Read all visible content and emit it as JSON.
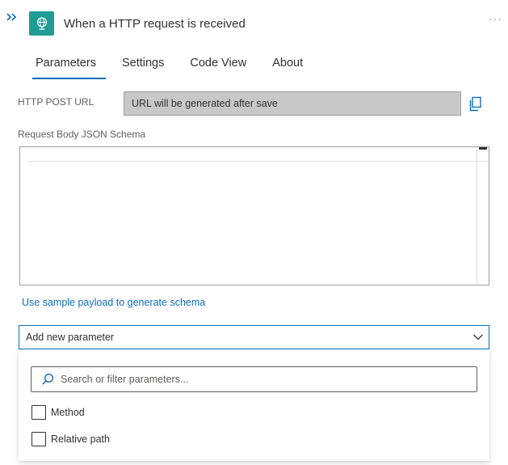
{
  "header": {
    "title": "When a HTTP request is received",
    "collapse_icon": "double-chevron-right-icon",
    "trigger_icon": "globe-request-icon",
    "more_label": "···"
  },
  "tabs": [
    {
      "label": "Parameters",
      "active": true
    },
    {
      "label": "Settings",
      "active": false
    },
    {
      "label": "Code View",
      "active": false
    },
    {
      "label": "About",
      "active": false
    }
  ],
  "fields": {
    "post_url_label": "HTTP POST URL",
    "post_url_value": "URL will be generated after save",
    "schema_label": "Request Body JSON Schema",
    "schema_value": ""
  },
  "sample_link": "Use sample payload to generate schema",
  "add_parameter": {
    "selected": "Add new parameter",
    "search_placeholder": "Search or filter parameters...",
    "options": [
      {
        "label": "Method",
        "checked": false
      },
      {
        "label": "Relative path",
        "checked": false
      }
    ]
  },
  "colors": {
    "accent": "#0f6cbd",
    "trigger_bg": "#1f9c94",
    "url_box_bg": "#c8c8c8"
  }
}
